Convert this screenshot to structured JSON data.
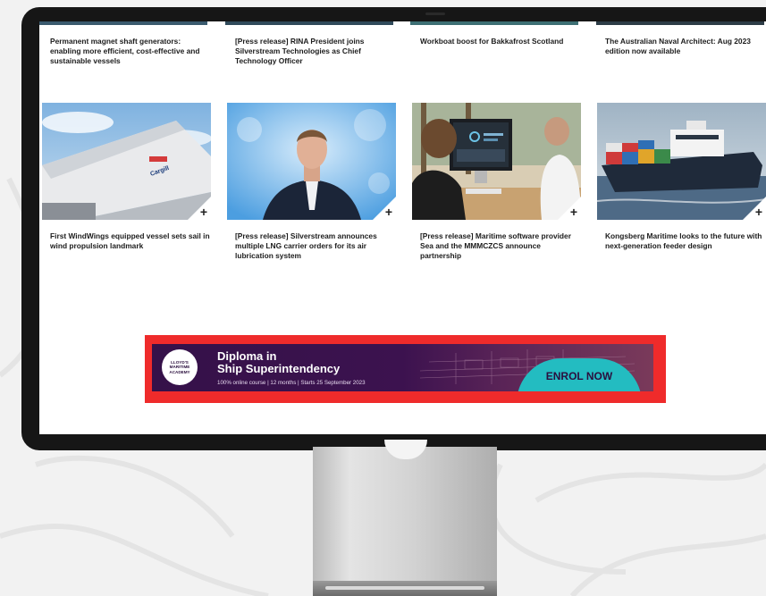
{
  "articles_top": [
    {
      "title": "Permanent magnet shaft generators: enabling more efficient, cost-effective and sustainable vessels",
      "strip_color": "#3a5a6e"
    },
    {
      "title": "[Press release] RINA President joins Silverstream Technologies as Chief Technology Officer",
      "strip_color": "#304a5a"
    },
    {
      "title": "Workboat boost for Bakkafrost Scotland",
      "strip_color": "#3d6f74"
    },
    {
      "title": "The Australian Naval Architect: Aug 2023 edition now available",
      "strip_color": "#2d3c46"
    }
  ],
  "articles_bottom": [
    {
      "title": "First WindWings equipped vessel sets sail in wind propulsion landmark",
      "image": "wingsail-ship-photo"
    },
    {
      "title": "[Press release] Silverstream announces multiple LNG carrier orders for its air lubrication system",
      "image": "executive-portrait-photo"
    },
    {
      "title": "[Press release] Maritime software provider Sea and the MMMCZCS announce partnership",
      "image": "office-computer-photo"
    },
    {
      "title": "Kongsberg Maritime looks to the future with next-generation feeder design",
      "image": "container-ship-photo"
    }
  ],
  "expand_symbol": "+",
  "banner": {
    "logo_text": "LLOYD'S MARITIME ACADEMY",
    "headline_line1": "Diploma in",
    "headline_line2": "Ship Superintendency",
    "subline": "100% online course | 12 months | Starts 25 September 2023",
    "cta_label": "ENROL NOW",
    "highlight_color": "#ef2b2b"
  }
}
